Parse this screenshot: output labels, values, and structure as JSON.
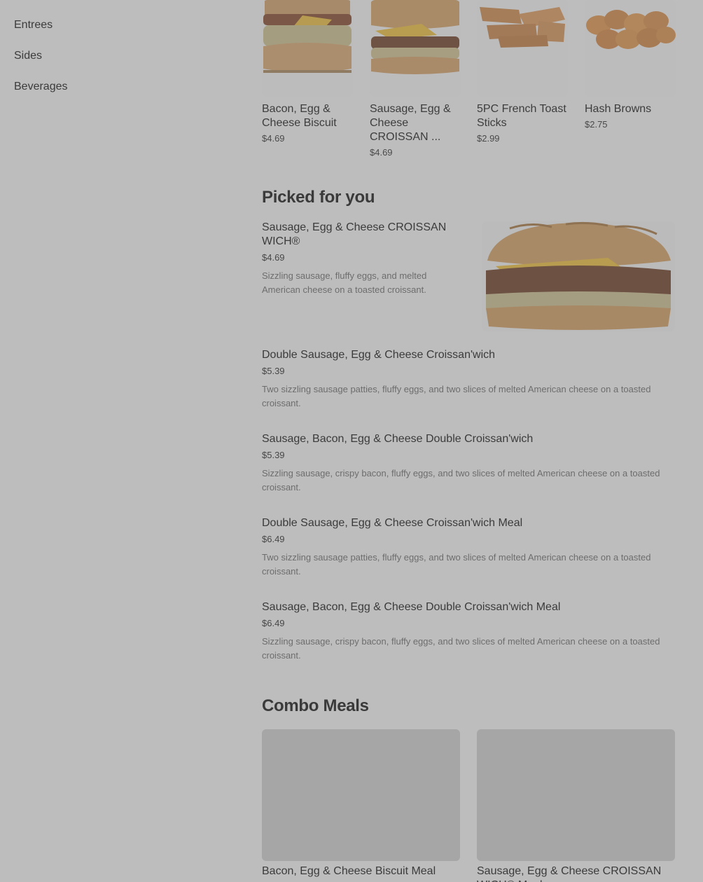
{
  "sidebar": {
    "items": [
      {
        "label": "Entrees"
      },
      {
        "label": "Sides"
      },
      {
        "label": "Beverages"
      }
    ]
  },
  "carousel": {
    "items": [
      {
        "name": "Bacon, Egg & Cheese Biscuit",
        "price": "$4.69",
        "image": "biscuit-sandwich"
      },
      {
        "name": "Sausage, Egg & Cheese CROISSAN ...",
        "price": "$4.69",
        "image": "croissant-sandwich"
      },
      {
        "name": "5PC French Toast Sticks",
        "price": "$2.99",
        "image": "french-toast-sticks"
      },
      {
        "name": "Hash Browns",
        "price": "$2.75",
        "image": "hash-browns"
      }
    ]
  },
  "picked": {
    "title": "Picked for you",
    "items": [
      {
        "name": "Sausage, Egg & Cheese CROISSAN WICH®",
        "price": "$4.69",
        "desc": "Sizzling sausage, fluffy eggs, and melted American cheese on a toasted croissant."
      },
      {
        "name": "Double Sausage, Egg & Cheese Croissan'wich",
        "price": "$5.39",
        "desc": "Two sizzling sausage patties, fluffy eggs, and two slices of melted American cheese on a toasted croissant."
      },
      {
        "name": "Sausage, Bacon, Egg & Cheese Double Croissan'wich",
        "price": "$5.39",
        "desc": "Sizzling sausage, crispy bacon, fluffy eggs, and two slices of melted American cheese on a toasted croissant."
      },
      {
        "name": "Double Sausage, Egg & Cheese Croissan'wich Meal",
        "price": "$6.49",
        "desc": "Two sizzling sausage patties, fluffy eggs, and two slices of melted American cheese on a toasted croissant."
      },
      {
        "name": "Sausage, Bacon, Egg & Cheese Double Croissan'wich Meal",
        "price": "$6.49",
        "desc": "Sizzling sausage, crispy bacon, fluffy eggs, and two slices of melted American cheese on a toasted croissant."
      }
    ]
  },
  "combo": {
    "title": "Combo Meals",
    "items": [
      {
        "name": "Bacon, Egg & Cheese Biscuit Meal"
      },
      {
        "name": "Sausage, Egg & Cheese CROISSAN WICH® Meal"
      }
    ]
  },
  "colors": {
    "overlay_background": "#bdbdbd",
    "text_primary": "#3b3b3b",
    "text_secondary": "#6d6d6d"
  }
}
